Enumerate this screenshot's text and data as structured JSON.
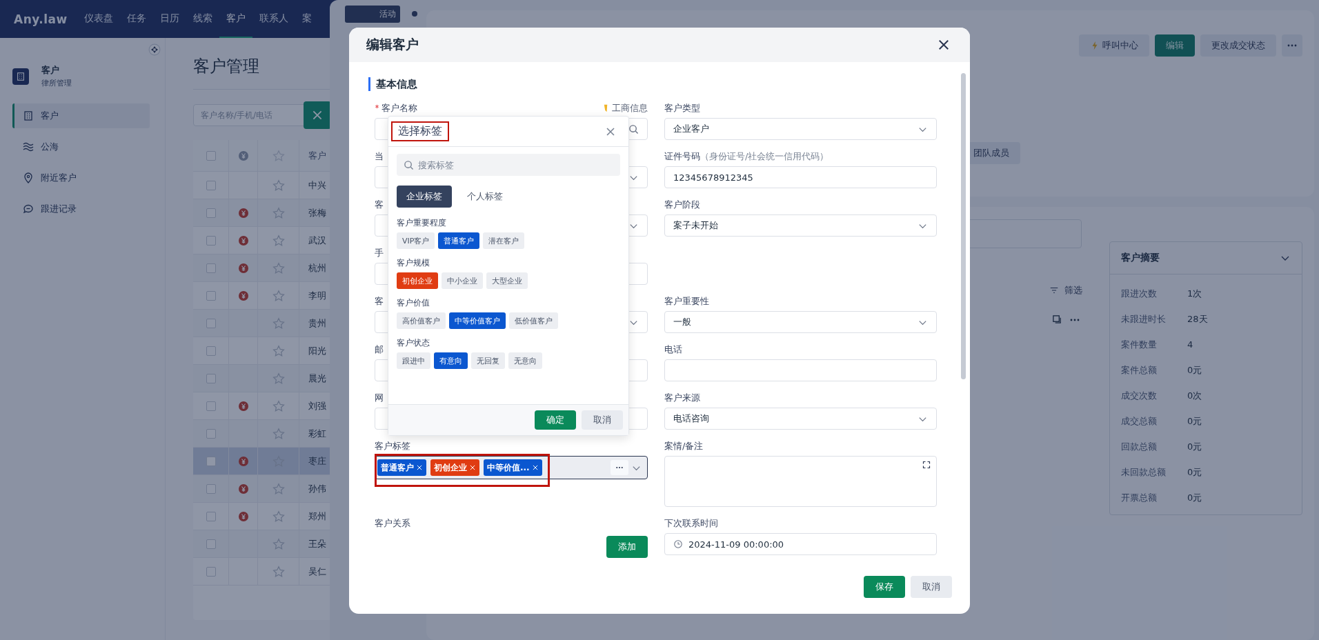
{
  "top_nav": {
    "logo": "Any.law",
    "items": [
      {
        "label": "仪表盘",
        "selected": false
      },
      {
        "label": "任务",
        "selected": false
      },
      {
        "label": "日历",
        "selected": false
      },
      {
        "label": "线索",
        "selected": false
      },
      {
        "label": "客户",
        "selected": true
      },
      {
        "label": "联系人",
        "selected": false
      },
      {
        "label": "案",
        "selected": false
      }
    ]
  },
  "sidebar": {
    "title": "客户",
    "subtitle": "律所管理",
    "items": [
      {
        "label": "客户",
        "kind": "building",
        "selected": true
      },
      {
        "label": "公海",
        "kind": "waves",
        "selected": false
      },
      {
        "label": "附近客户",
        "kind": "pin",
        "selected": false
      },
      {
        "label": "跟进记录",
        "kind": "chat",
        "selected": false
      }
    ]
  },
  "page": {
    "title": "客户管理",
    "search": {
      "placeholder": "客户名称/手机/电话"
    }
  },
  "table": {
    "header_checked": false,
    "name_header": "客户",
    "rows": [
      {
        "name": "中兴",
        "paid": false,
        "selected": false
      },
      {
        "name": "张梅",
        "paid": true,
        "selected": false
      },
      {
        "name": "武汉",
        "paid": true,
        "selected": false
      },
      {
        "name": "杭州",
        "paid": true,
        "selected": false
      },
      {
        "name": "李明",
        "paid": true,
        "selected": false
      },
      {
        "name": "贵州",
        "paid": false,
        "selected": false
      },
      {
        "name": "阳光",
        "paid": false,
        "selected": false
      },
      {
        "name": "晨光",
        "paid": false,
        "selected": false
      },
      {
        "name": "刘强",
        "paid": true,
        "selected": false
      },
      {
        "name": "彩虹",
        "paid": false,
        "selected": false
      },
      {
        "name": "枣庄",
        "paid": true,
        "selected": true
      },
      {
        "name": "孙伟",
        "paid": true,
        "selected": false
      },
      {
        "name": "郑州",
        "paid": true,
        "selected": false
      },
      {
        "name": "王朵",
        "paid": false,
        "selected": false
      },
      {
        "name": "吴仁",
        "paid": false,
        "selected": false
      }
    ]
  },
  "drawer": {
    "tab": "活动",
    "actions": [
      {
        "kind": "call",
        "label": "呼叫中心"
      },
      {
        "kind": "primary",
        "label": "编辑"
      },
      {
        "kind": "plain",
        "label": "更改成交状态"
      },
      {
        "kind": "more"
      }
    ],
    "team_button": "团队成员",
    "filter": "筛选",
    "summary": {
      "title": "客户摘要",
      "rows": [
        {
          "label": "跟进次数",
          "value": "1次"
        },
        {
          "label": "未跟进时长",
          "value": "28天"
        },
        {
          "label": "案件数量",
          "value": "4"
        },
        {
          "label": "案件总额",
          "value": "0元"
        },
        {
          "label": "成交次数",
          "value": "0次"
        },
        {
          "label": "成交总额",
          "value": "0元"
        },
        {
          "label": "回款总额",
          "value": "0元"
        },
        {
          "label": "未回款总额",
          "value": "0元"
        },
        {
          "label": "开票总额",
          "value": "0元"
        }
      ]
    }
  },
  "modal": {
    "title": "编辑客户",
    "section": "基本信息",
    "rows": [
      [
        {
          "kind": "search",
          "label": "客户名称",
          "required": true,
          "extra": "工商信息"
        },
        {
          "kind": "select",
          "label": "客户类型",
          "value": "企业客户"
        }
      ],
      [
        {
          "kind": "select",
          "label": "当"
        },
        {
          "kind": "text",
          "label": "证件号码",
          "hint": "（身份证号/社会统一信用代码）",
          "value": "12345678912345"
        }
      ],
      [
        {
          "kind": "select",
          "label": "客"
        },
        {
          "kind": "select",
          "label": "客户阶段",
          "value": "案子未开始"
        }
      ],
      [
        {
          "kind": "text",
          "label": "手"
        },
        {
          "kind": "blank"
        }
      ],
      [
        {
          "kind": "select",
          "label": "客"
        },
        {
          "kind": "select",
          "label": "客户重要性",
          "value": "一般"
        }
      ],
      [
        {
          "kind": "text",
          "label": "邮"
        },
        {
          "kind": "text",
          "label": "电话"
        }
      ],
      [
        {
          "kind": "text",
          "label": "网"
        },
        {
          "kind": "select",
          "label": "客户来源",
          "value": "电话咨询"
        }
      ],
      [
        {
          "kind": "tags",
          "label": "客户标签",
          "annotated": true,
          "tags": [
            {
              "label": "普通客户",
              "color": "#0b57d0"
            },
            {
              "label": "初创企业",
              "color": "#e03c12"
            },
            {
              "label": "中等价值...",
              "color": "#0b57d0"
            }
          ]
        },
        {
          "kind": "textarea",
          "label": "案情/备注"
        }
      ],
      [
        {
          "kind": "add",
          "label": "客户关系",
          "button": "添加"
        },
        {
          "kind": "date",
          "label": "下次联系时间",
          "value": "2024-11-09 00:00:00"
        }
      ]
    ],
    "buttons": [
      {
        "kind": "primary",
        "label": "保存"
      },
      {
        "kind": "secondary",
        "label": "取消"
      }
    ]
  },
  "tag_picker": {
    "title": "选择标签",
    "annotated": true,
    "search_placeholder": "搜索标签",
    "tabs": [
      {
        "label": "企业标签",
        "selected": true
      },
      {
        "label": "个人标签",
        "selected": false
      }
    ],
    "groups": [
      {
        "title": "客户重要程度",
        "tags": [
          {
            "label": "VIP客户",
            "selected": false
          },
          {
            "label": "普通客户",
            "selected": true,
            "color": "#0b57d0"
          },
          {
            "label": "潜在客户",
            "selected": false
          }
        ]
      },
      {
        "title": "客户规模",
        "tags": [
          {
            "label": "初创企业",
            "selected": true,
            "color": "#e03c12"
          },
          {
            "label": "中小企业",
            "selected": false
          },
          {
            "label": "大型企业",
            "selected": false
          }
        ]
      },
      {
        "title": "客户价值",
        "tags": [
          {
            "label": "高价值客户",
            "selected": false
          },
          {
            "label": "中等价值客户",
            "selected": true,
            "color": "#0b57d0"
          },
          {
            "label": "低价值客户",
            "selected": false
          }
        ]
      },
      {
        "title": "客户状态",
        "tags": [
          {
            "label": "跟进中",
            "selected": false
          },
          {
            "label": "有意向",
            "selected": true,
            "color": "#0b57d0"
          },
          {
            "label": "无回复",
            "selected": false
          },
          {
            "label": "无意向",
            "selected": false
          }
        ]
      }
    ],
    "buttons": [
      {
        "kind": "primary",
        "label": "确定"
      },
      {
        "kind": "secondary",
        "label": "取消"
      }
    ]
  }
}
